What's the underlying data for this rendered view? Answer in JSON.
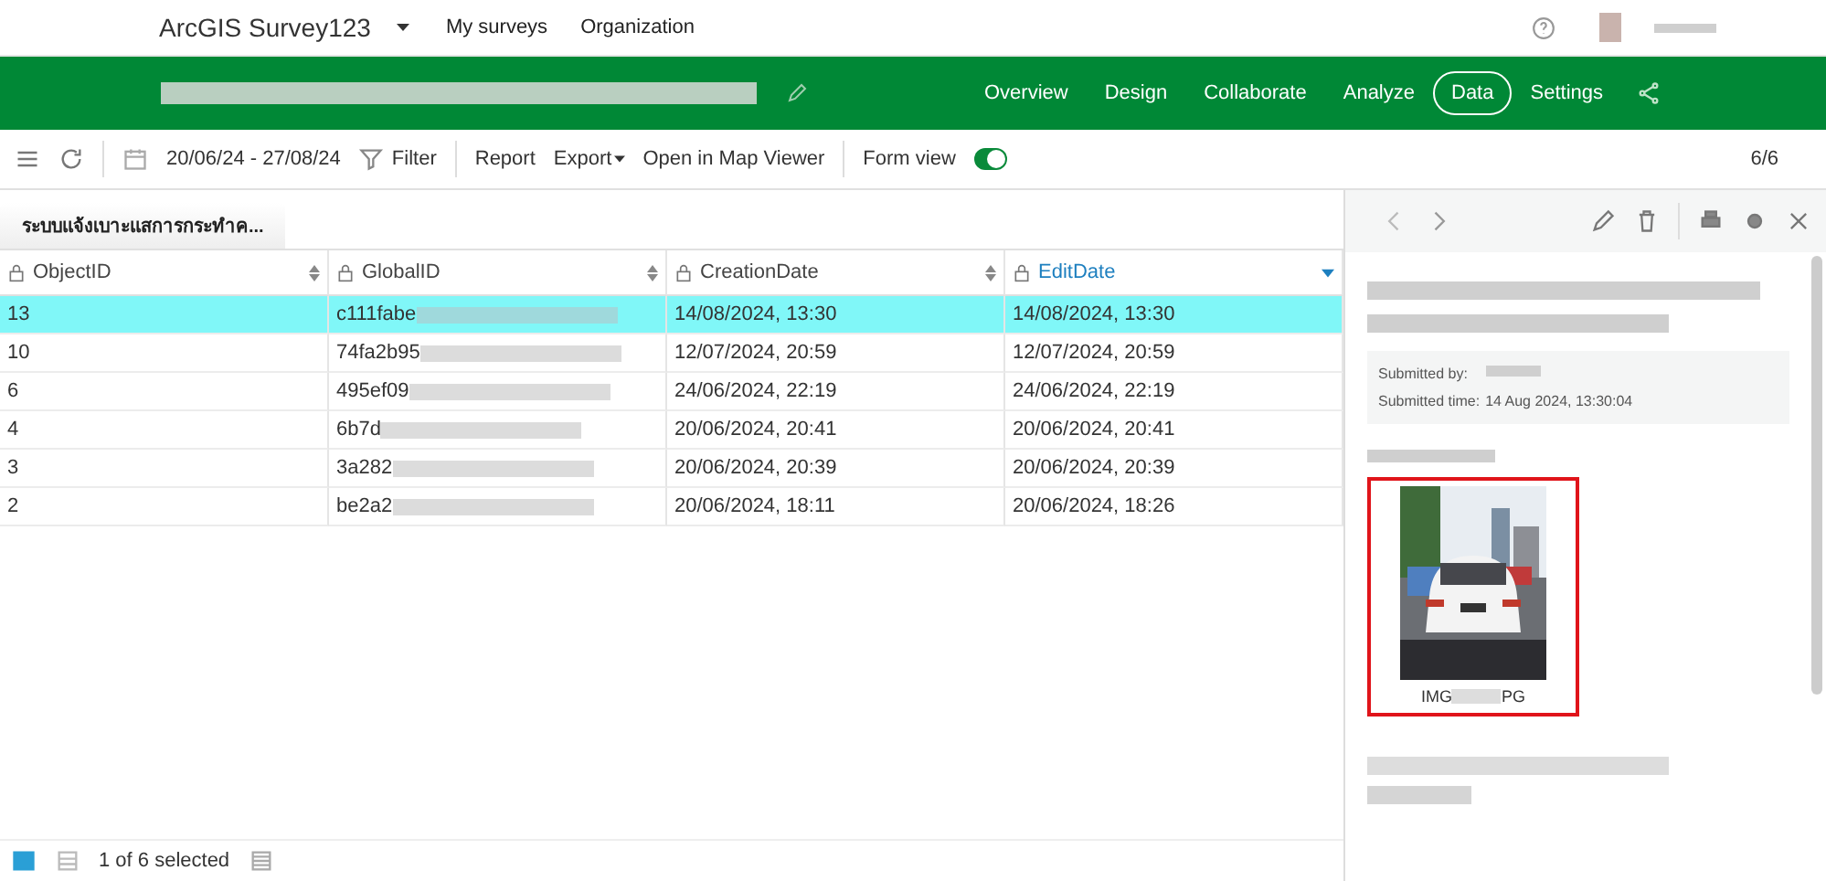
{
  "app_bar": {
    "title": "ArcGIS Survey123",
    "links": [
      "My surveys",
      "Organization"
    ]
  },
  "survey_bar": {
    "tabs": [
      {
        "label": "Overview",
        "selected": false
      },
      {
        "label": "Design",
        "selected": false
      },
      {
        "label": "Collaborate",
        "selected": false
      },
      {
        "label": "Analyze",
        "selected": false
      },
      {
        "label": "Data",
        "selected": true
      },
      {
        "label": "Settings",
        "selected": false
      }
    ]
  },
  "toolbar": {
    "date_range": "20/06/24 - 27/08/24",
    "filter": "Filter",
    "report": "Report",
    "export": "Export",
    "map_viewer": "Open in Map Viewer",
    "form_view": {
      "label": "Form view",
      "on": true
    },
    "record_count": "6/6"
  },
  "layer_tab": "ระบบแจ้งเบาะแสการกระทำค...",
  "table": {
    "columns": [
      {
        "label": "ObjectID",
        "sorted": false
      },
      {
        "label": "GlobalID",
        "sorted": false
      },
      {
        "label": "CreationDate",
        "sorted": false
      },
      {
        "label": "EditDate",
        "sorted": true
      }
    ],
    "rows": [
      {
        "selected": true,
        "cells": [
          "13",
          "c111fabe",
          "14/08/2024, 13:30",
          "14/08/2024, 13:30"
        ]
      },
      {
        "selected": false,
        "cells": [
          "10",
          "74fa2b95",
          "12/07/2024, 20:59",
          "12/07/2024, 20:59"
        ]
      },
      {
        "selected": false,
        "cells": [
          "6",
          "495ef09",
          "24/06/2024, 22:19",
          "24/06/2024, 22:19"
        ]
      },
      {
        "selected": false,
        "cells": [
          "4",
          "6b7d",
          "20/06/2024, 20:41",
          "20/06/2024, 20:41"
        ]
      },
      {
        "selected": false,
        "cells": [
          "3",
          "3a282",
          "20/06/2024, 20:39",
          "20/06/2024, 20:39"
        ]
      },
      {
        "selected": false,
        "cells": [
          "2",
          "be2a2",
          "20/06/2024, 18:11",
          "20/06/2024, 18:26"
        ]
      }
    ]
  },
  "status_bar": {
    "selection": "1 of 6 selected"
  },
  "record_panel": {
    "submitted_by_label": "Submitted by:",
    "submitted_time_label": "Submitted time:",
    "submitted_time": "14 Aug 2024, 13:30:04",
    "attachment": {
      "kind": "picture",
      "caption_start": "IMG",
      "caption_end": "PG"
    }
  }
}
